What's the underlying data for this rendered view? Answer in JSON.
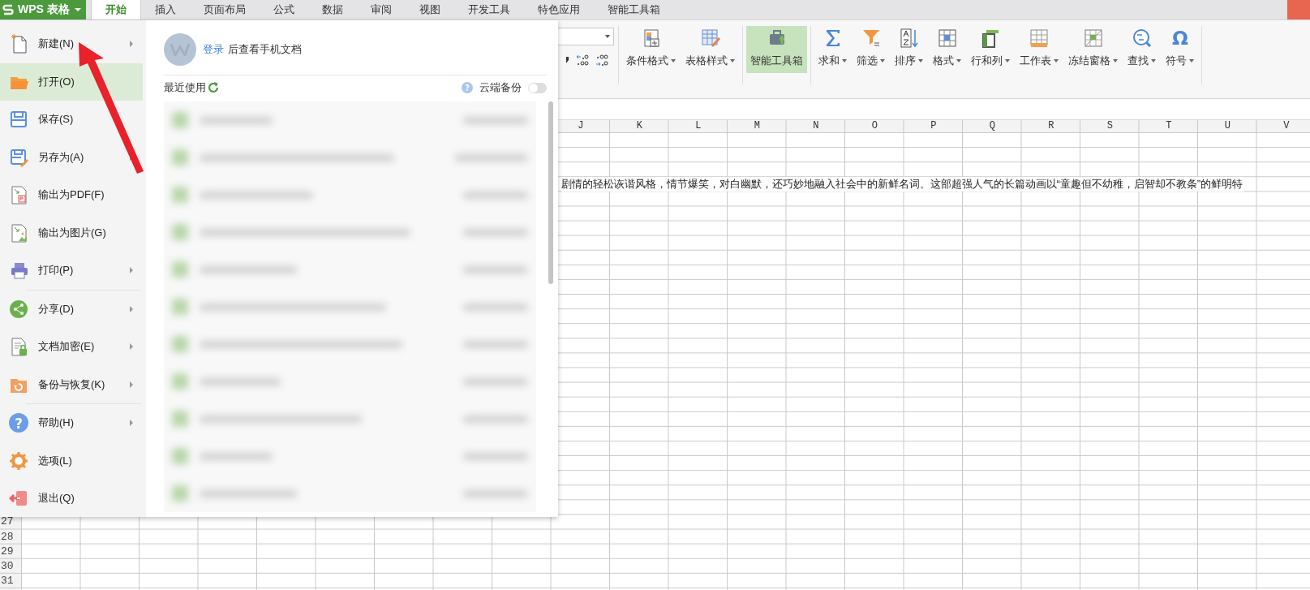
{
  "app_button": {
    "label": "WPS 表格"
  },
  "tabs": [
    {
      "label": "开始",
      "selected": true
    },
    {
      "label": "插入",
      "selected": false
    },
    {
      "label": "页面布局",
      "selected": false
    },
    {
      "label": "公式",
      "selected": false
    },
    {
      "label": "数据",
      "selected": false
    },
    {
      "label": "审阅",
      "selected": false
    },
    {
      "label": "视图",
      "selected": false
    },
    {
      "label": "开发工具",
      "selected": false
    },
    {
      "label": "特色应用",
      "selected": false
    },
    {
      "label": "智能工具箱",
      "selected": false
    }
  ],
  "ribbon": {
    "groups": [
      [
        {
          "label": "条件格式",
          "dropdown": true,
          "selected": false
        },
        {
          "label": "表格样式",
          "dropdown": true,
          "selected": false
        }
      ],
      [
        {
          "label": "智能工具箱",
          "dropdown": false,
          "selected": true
        }
      ],
      [
        {
          "label": "求和",
          "dropdown": true,
          "selected": false
        },
        {
          "label": "筛选",
          "dropdown": true,
          "selected": false
        },
        {
          "label": "排序",
          "dropdown": true,
          "selected": false
        },
        {
          "label": "格式",
          "dropdown": true,
          "selected": false
        },
        {
          "label": "行和列",
          "dropdown": true,
          "selected": false
        },
        {
          "label": "工作表",
          "dropdown": true,
          "selected": false
        },
        {
          "label": "冻结窗格",
          "dropdown": true,
          "selected": false
        },
        {
          "label": "查找",
          "dropdown": true,
          "selected": false
        },
        {
          "label": "符号",
          "dropdown": true,
          "selected": false,
          "icon_char": "Ω"
        }
      ]
    ]
  },
  "file_menu": {
    "groups": [
      [
        {
          "label": "新建(N)",
          "submenu": true,
          "selected": false
        },
        {
          "label": "打开(O)",
          "submenu": false,
          "selected": true
        },
        {
          "label": "保存(S)",
          "submenu": false,
          "selected": false
        },
        {
          "label": "另存为(A)",
          "submenu": true,
          "selected": false
        },
        {
          "label": "输出为PDF(F)",
          "submenu": false,
          "selected": false
        },
        {
          "label": "输出为图片(G)",
          "submenu": false,
          "selected": false
        },
        {
          "label": "打印(P)",
          "submenu": true,
          "selected": false
        }
      ],
      [
        {
          "label": "分享(D)",
          "submenu": true,
          "selected": false
        },
        {
          "label": "文档加密(E)",
          "submenu": true,
          "selected": false
        },
        {
          "label": "备份与恢复(K)",
          "submenu": true,
          "selected": false
        }
      ],
      [
        {
          "label": "帮助(H)",
          "submenu": true,
          "selected": false,
          "icon_char": "?"
        },
        {
          "label": "选项(L)",
          "submenu": false,
          "selected": false
        },
        {
          "label": "退出(Q)",
          "submenu": false,
          "selected": false
        }
      ]
    ]
  },
  "recent_panel": {
    "login_link": "登录",
    "login_text": "后查看手机文档",
    "recent_label": "最近使用",
    "help_icon_char": "?",
    "cloud_backup": {
      "label": "云端备份",
      "on": false
    }
  },
  "sheet": {
    "column_headers": [
      "J",
      "K",
      "L",
      "M",
      "N",
      "O",
      "P",
      "Q",
      "R",
      "S",
      "T",
      "U",
      "V"
    ],
    "row_headers": [
      "27",
      "28",
      "29",
      "30",
      "31"
    ],
    "text": "剧情的轻松诙谐风格，情节爆笑，对白幽默，还巧妙地融入社会中的新鲜名词。这部超强人气的长篇动画以“童趣但不幼稚，启智却不教条”的鲜明特"
  }
}
